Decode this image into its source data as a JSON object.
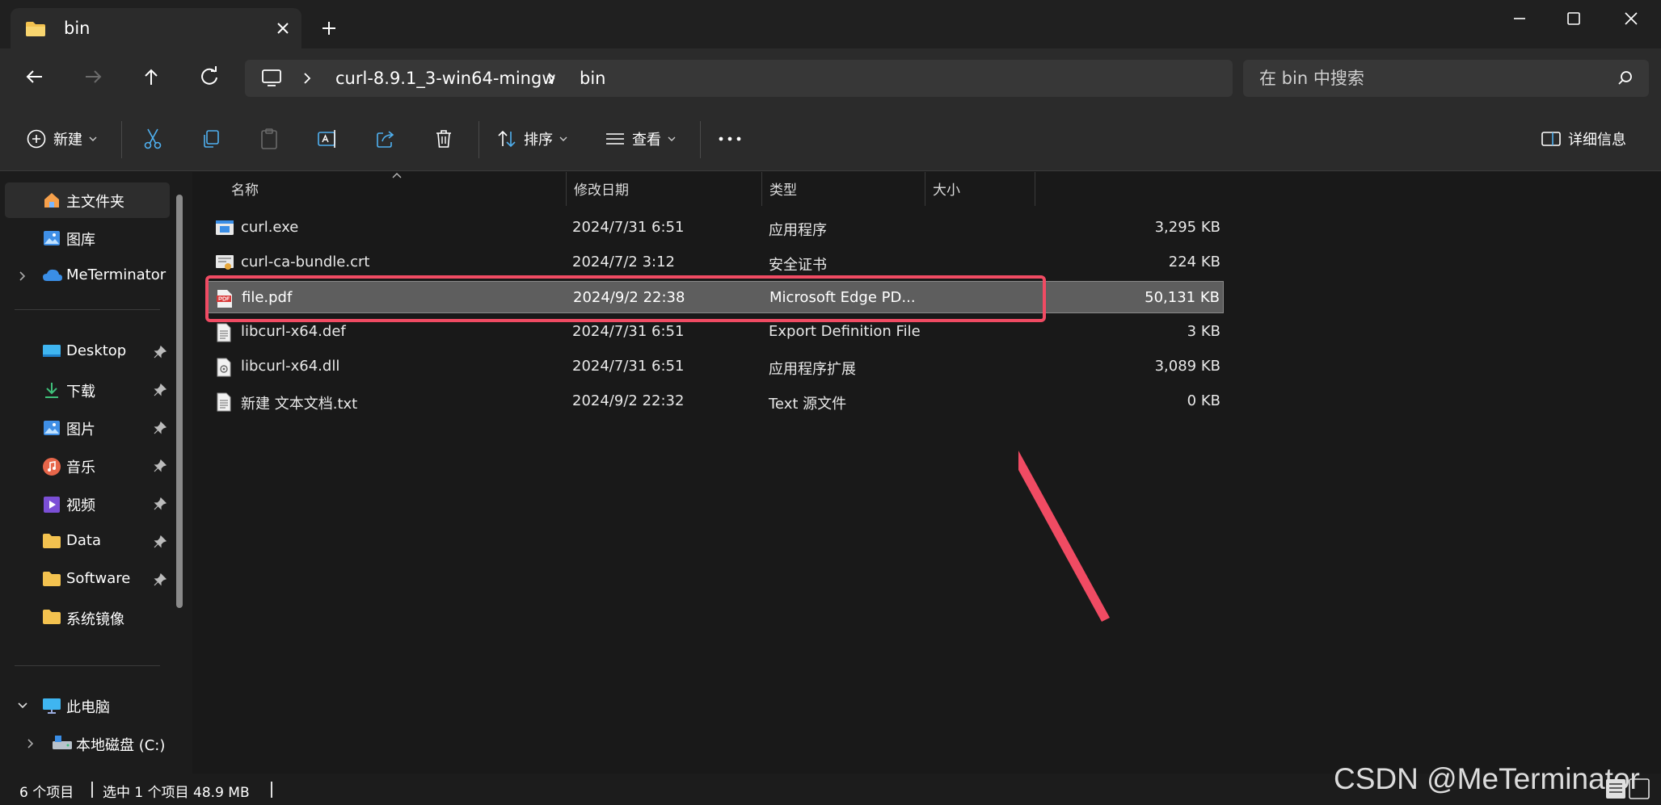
{
  "tab": {
    "title": "bin"
  },
  "address": {
    "crumbs": [
      "curl-8.9.1_3-win64-mingw",
      "bin"
    ],
    "search_placeholder": "在 bin 中搜索"
  },
  "commands": {
    "new_label": "新建",
    "sort_label": "排序",
    "view_label": "查看",
    "details_label": "详细信息"
  },
  "sidebar": {
    "home": "主文件夹",
    "gallery": "图库",
    "onedrive": "MeTerminator",
    "pinned": [
      "Desktop",
      "下载",
      "图片",
      "音乐",
      "视频",
      "Data",
      "Software",
      "系统镜像"
    ],
    "this_pc": "此电脑",
    "drive_c": "本地磁盘 (C:)"
  },
  "columns": {
    "name": "名称",
    "date": "修改日期",
    "type": "类型",
    "size": "大小"
  },
  "files": [
    {
      "name": "curl.exe",
      "date": "2024/7/31 6:51",
      "type": "应用程序",
      "size": "3,295 KB",
      "icon": "exe-icon"
    },
    {
      "name": "curl-ca-bundle.crt",
      "date": "2024/7/2 3:12",
      "type": "安全证书",
      "size": "224 KB",
      "icon": "certificate-icon"
    },
    {
      "name": "file.pdf",
      "date": "2024/9/2 22:38",
      "type": "Microsoft Edge PD...",
      "size": "50,131 KB",
      "icon": "pdf-icon"
    },
    {
      "name": "libcurl-x64.def",
      "date": "2024/7/31 6:51",
      "type": "Export Definition File",
      "size": "3 KB",
      "icon": "text-file-icon"
    },
    {
      "name": "libcurl-x64.dll",
      "date": "2024/7/31 6:51",
      "type": "应用程序扩展",
      "size": "3,089 KB",
      "icon": "dll-icon"
    },
    {
      "name": "新建 文本文档.txt",
      "date": "2024/9/2 22:32",
      "type": "Text 源文件",
      "size": "0 KB",
      "icon": "text-file-icon"
    }
  ],
  "status": {
    "count": "6 个项目",
    "selection": "选中 1 个项目  48.9 MB"
  },
  "watermark": "CSDN @MeTerminator",
  "colors": {
    "highlight": "#f04b63",
    "selection": "#5e5e5e",
    "folder": "#f3c24f"
  }
}
